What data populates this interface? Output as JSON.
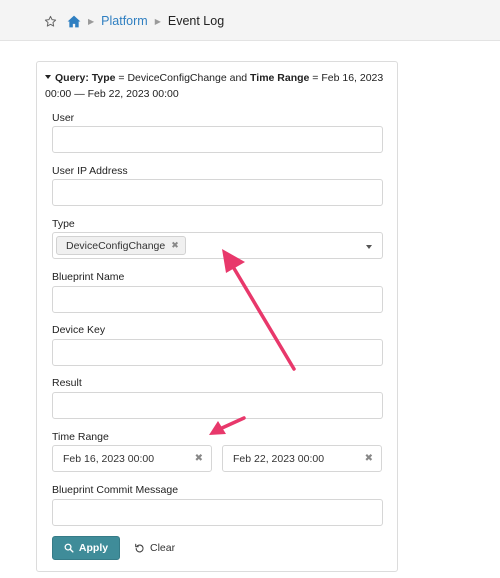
{
  "breadcrumb": {
    "items": [
      "Platform"
    ],
    "current": "Event Log"
  },
  "query": {
    "prefix": "Query:",
    "k1": "Type",
    "op1": " = DeviceConfigChange and ",
    "k2": "Time Range",
    "op2": " = Feb 16, 2023 00:00 — Feb 22, 2023 00:00"
  },
  "form": {
    "user": {
      "label": "User",
      "value": ""
    },
    "user_ip": {
      "label": "User IP Address",
      "value": ""
    },
    "type": {
      "label": "Type",
      "selected_tag": "DeviceConfigChange"
    },
    "blueprint_name": {
      "label": "Blueprint Name",
      "value": ""
    },
    "device_key": {
      "label": "Device Key",
      "value": ""
    },
    "result": {
      "label": "Result",
      "value": ""
    },
    "time_range": {
      "label": "Time Range",
      "start": "Feb 16, 2023 00:00",
      "end": "Feb 22, 2023 00:00"
    },
    "commit_message": {
      "label": "Blueprint Commit Message",
      "value": ""
    }
  },
  "actions": {
    "apply_label": "Apply",
    "clear_label": "Clear"
  },
  "colors": {
    "link": "#2f7fc1",
    "apply_bg": "#3f8c99",
    "annotation_arrow": "#e8386b"
  },
  "icons": {
    "favorite": "star-icon",
    "home": "home-icon",
    "apply": "search-icon",
    "clear": "undo-icon"
  }
}
